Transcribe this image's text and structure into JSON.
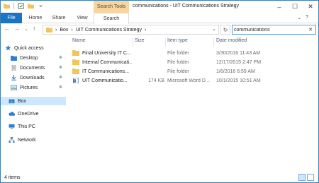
{
  "window": {
    "title": "communications - UIT Communications Strategy",
    "context_tab": "Search Tools",
    "controls": [
      "–",
      "☐",
      "✕"
    ]
  },
  "ribbon": {
    "tabs": [
      "File",
      "Home",
      "Share",
      "View",
      "Search"
    ],
    "right_icons": [
      "⌄",
      "?"
    ]
  },
  "address": {
    "crumbs": [
      "Box",
      "UIT Communications Strategy"
    ],
    "dropdown": "⌄"
  },
  "search": {
    "value": "communications",
    "clear": "✕"
  },
  "nav": {
    "back": "←",
    "forward": "→",
    "recent": "⌄",
    "up": "↑",
    "refresh": "↻"
  },
  "sidebar": {
    "items": [
      {
        "label": "Quick access",
        "icon": "star-icon"
      },
      {
        "label": "Desktop",
        "icon": "folder-icon",
        "pinned": true
      },
      {
        "label": "Documents",
        "icon": "documents-icon",
        "pinned": true
      },
      {
        "label": "Downloads",
        "icon": "downloads-icon",
        "pinned": true
      },
      {
        "label": "Pictures",
        "icon": "pictures-icon",
        "pinned": true
      },
      {
        "label": "Box",
        "icon": "box-icon"
      },
      {
        "label": "OneDrive",
        "icon": "cloud-icon"
      },
      {
        "label": "This PC",
        "icon": "pc-icon"
      },
      {
        "label": "Network",
        "icon": "network-icon"
      }
    ]
  },
  "columns": [
    "Name",
    "Size",
    "Item type",
    "Date modified"
  ],
  "files": [
    {
      "name": "Final University IT C...",
      "size": "",
      "type": "File folder",
      "date": "3/30/2016 11:43 AM",
      "icon": "folder-icon"
    },
    {
      "name": "Internal Communicati...",
      "size": "",
      "type": "File folder",
      "date": "12/17/2015 2:47 PM",
      "icon": "folder-icon"
    },
    {
      "name": "IT Communications...",
      "size": "",
      "type": "File folder",
      "date": "1/6/2016 6:59 AM",
      "icon": "folder-icon"
    },
    {
      "name": "UIT Communicatio...",
      "size": "174 KB",
      "type": "Microsoft Word D...",
      "date": "10/1/2015 10:51 AM",
      "icon": "word-doc-icon"
    }
  ],
  "status": {
    "count": "4 items"
  },
  "colors": {
    "file_tab": "#1a74c3",
    "context_tab": "#f7d5a3",
    "selection": "#cce8ff",
    "folder": "#f2c55c"
  }
}
